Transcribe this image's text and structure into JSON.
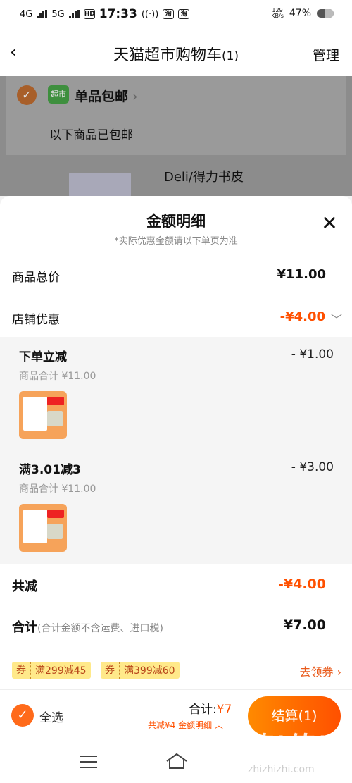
{
  "status": {
    "time": "17:33",
    "net_left": "4G",
    "net_left2": "5G",
    "hd": "HD",
    "netspeed_top": "129",
    "netspeed_bottom": "KB/s",
    "battery": "47%"
  },
  "header": {
    "back": "‹",
    "title": "天猫超市购物车",
    "count": "(1)",
    "manage": "管理"
  },
  "background": {
    "shop_logo": "超市",
    "shop_tag": "单品包邮",
    "shop_chevron": "›",
    "shipping_note": "以下商品已包邮",
    "product_name": "Deli/得力书皮"
  },
  "sheet": {
    "title": "金额明细",
    "subtitle": "*实际优惠金额请以下单页为准",
    "close": "✕",
    "goods_total_label": "商品总价",
    "goods_total_value": "¥11.00",
    "shop_discount_label": "店铺优惠",
    "shop_discount_value": "-¥4.00",
    "discounts": [
      {
        "title": "下单立减",
        "amount": "- ¥1.00",
        "sub": "商品合计 ¥11.00"
      },
      {
        "title": "满3.01减3",
        "amount": "- ¥3.00",
        "sub": "商品合计 ¥11.00"
      }
    ],
    "total_reduce_label": "共减",
    "total_reduce_value": "-¥4.00",
    "sum_label": "合计",
    "sum_note": "(合计金额不含运费、进口税)",
    "sum_value": "¥7.00",
    "coupons": [
      {
        "key": "券",
        "text": "满299减45"
      },
      {
        "key": "券",
        "text": "满399减60"
      }
    ],
    "get_coupon": "去领券 ›"
  },
  "bottom": {
    "check": "✓",
    "select_all": "全选",
    "total_label": "合计:",
    "total_value": "¥7",
    "reduce_note": "共减¥4   金额明细 ︿",
    "checkout": "结算(1)"
  },
  "watermark": {
    "big": "值|值|值",
    "small": "zhizhizhi.com"
  }
}
